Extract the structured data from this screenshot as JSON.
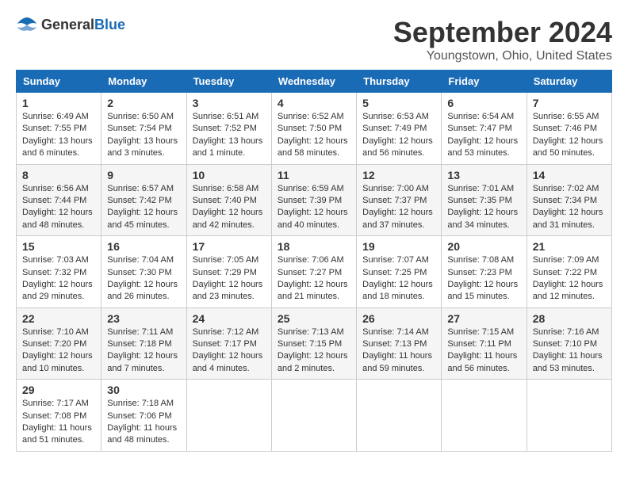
{
  "logo": {
    "general": "General",
    "blue": "Blue"
  },
  "header": {
    "month": "September 2024",
    "location": "Youngstown, Ohio, United States"
  },
  "weekdays": [
    "Sunday",
    "Monday",
    "Tuesday",
    "Wednesday",
    "Thursday",
    "Friday",
    "Saturday"
  ],
  "weeks": [
    [
      {
        "day": "1",
        "sunrise": "6:49 AM",
        "sunset": "7:55 PM",
        "daylight": "13 hours and 6 minutes."
      },
      {
        "day": "2",
        "sunrise": "6:50 AM",
        "sunset": "7:54 PM",
        "daylight": "13 hours and 3 minutes."
      },
      {
        "day": "3",
        "sunrise": "6:51 AM",
        "sunset": "7:52 PM",
        "daylight": "13 hours and 1 minute."
      },
      {
        "day": "4",
        "sunrise": "6:52 AM",
        "sunset": "7:50 PM",
        "daylight": "12 hours and 58 minutes."
      },
      {
        "day": "5",
        "sunrise": "6:53 AM",
        "sunset": "7:49 PM",
        "daylight": "12 hours and 56 minutes."
      },
      {
        "day": "6",
        "sunrise": "6:54 AM",
        "sunset": "7:47 PM",
        "daylight": "12 hours and 53 minutes."
      },
      {
        "day": "7",
        "sunrise": "6:55 AM",
        "sunset": "7:46 PM",
        "daylight": "12 hours and 50 minutes."
      }
    ],
    [
      {
        "day": "8",
        "sunrise": "6:56 AM",
        "sunset": "7:44 PM",
        "daylight": "12 hours and 48 minutes."
      },
      {
        "day": "9",
        "sunrise": "6:57 AM",
        "sunset": "7:42 PM",
        "daylight": "12 hours and 45 minutes."
      },
      {
        "day": "10",
        "sunrise": "6:58 AM",
        "sunset": "7:40 PM",
        "daylight": "12 hours and 42 minutes."
      },
      {
        "day": "11",
        "sunrise": "6:59 AM",
        "sunset": "7:39 PM",
        "daylight": "12 hours and 40 minutes."
      },
      {
        "day": "12",
        "sunrise": "7:00 AM",
        "sunset": "7:37 PM",
        "daylight": "12 hours and 37 minutes."
      },
      {
        "day": "13",
        "sunrise": "7:01 AM",
        "sunset": "7:35 PM",
        "daylight": "12 hours and 34 minutes."
      },
      {
        "day": "14",
        "sunrise": "7:02 AM",
        "sunset": "7:34 PM",
        "daylight": "12 hours and 31 minutes."
      }
    ],
    [
      {
        "day": "15",
        "sunrise": "7:03 AM",
        "sunset": "7:32 PM",
        "daylight": "12 hours and 29 minutes."
      },
      {
        "day": "16",
        "sunrise": "7:04 AM",
        "sunset": "7:30 PM",
        "daylight": "12 hours and 26 minutes."
      },
      {
        "day": "17",
        "sunrise": "7:05 AM",
        "sunset": "7:29 PM",
        "daylight": "12 hours and 23 minutes."
      },
      {
        "day": "18",
        "sunrise": "7:06 AM",
        "sunset": "7:27 PM",
        "daylight": "12 hours and 21 minutes."
      },
      {
        "day": "19",
        "sunrise": "7:07 AM",
        "sunset": "7:25 PM",
        "daylight": "12 hours and 18 minutes."
      },
      {
        "day": "20",
        "sunrise": "7:08 AM",
        "sunset": "7:23 PM",
        "daylight": "12 hours and 15 minutes."
      },
      {
        "day": "21",
        "sunrise": "7:09 AM",
        "sunset": "7:22 PM",
        "daylight": "12 hours and 12 minutes."
      }
    ],
    [
      {
        "day": "22",
        "sunrise": "7:10 AM",
        "sunset": "7:20 PM",
        "daylight": "12 hours and 10 minutes."
      },
      {
        "day": "23",
        "sunrise": "7:11 AM",
        "sunset": "7:18 PM",
        "daylight": "12 hours and 7 minutes."
      },
      {
        "day": "24",
        "sunrise": "7:12 AM",
        "sunset": "7:17 PM",
        "daylight": "12 hours and 4 minutes."
      },
      {
        "day": "25",
        "sunrise": "7:13 AM",
        "sunset": "7:15 PM",
        "daylight": "12 hours and 2 minutes."
      },
      {
        "day": "26",
        "sunrise": "7:14 AM",
        "sunset": "7:13 PM",
        "daylight": "11 hours and 59 minutes."
      },
      {
        "day": "27",
        "sunrise": "7:15 AM",
        "sunset": "7:11 PM",
        "daylight": "11 hours and 56 minutes."
      },
      {
        "day": "28",
        "sunrise": "7:16 AM",
        "sunset": "7:10 PM",
        "daylight": "11 hours and 53 minutes."
      }
    ],
    [
      {
        "day": "29",
        "sunrise": "7:17 AM",
        "sunset": "7:08 PM",
        "daylight": "11 hours and 51 minutes."
      },
      {
        "day": "30",
        "sunrise": "7:18 AM",
        "sunset": "7:06 PM",
        "daylight": "11 hours and 48 minutes."
      },
      null,
      null,
      null,
      null,
      null
    ]
  ],
  "labels": {
    "sunrise": "Sunrise:",
    "sunset": "Sunset:",
    "daylight": "Daylight:"
  }
}
